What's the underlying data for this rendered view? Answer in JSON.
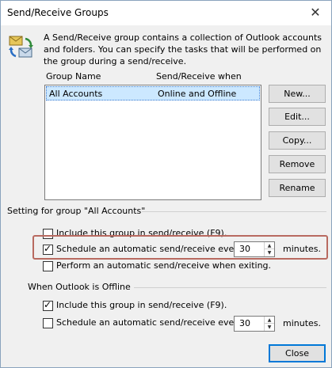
{
  "window": {
    "title": "Send/Receive Groups",
    "close_glyph": "✕"
  },
  "description": "A Send/Receive group contains a collection of Outlook accounts and folders. You can specify the tasks that will be performed on the group during a send/receive.",
  "list": {
    "col_group_name": "Group Name",
    "col_when": "Send/Receive when",
    "rows": [
      {
        "name": "All Accounts",
        "when": "Online and Offline"
      }
    ]
  },
  "buttons": {
    "new": "New...",
    "edit": "Edit...",
    "copy": "Copy...",
    "remove": "Remove",
    "rename": "Rename",
    "close": "Close"
  },
  "setting_group": {
    "label": "Setting for group \"All Accounts\"",
    "include": {
      "label": "Include this group in send/receive (F9).",
      "checked": false
    },
    "schedule": {
      "label": "Schedule an automatic send/receive every",
      "value": "30",
      "unit": "minutes.",
      "checked": true
    },
    "exiting": {
      "label": "Perform an automatic send/receive when exiting.",
      "checked": false
    }
  },
  "offline_group": {
    "label": "When Outlook is Offline",
    "include": {
      "label": "Include this group in send/receive (F9).",
      "checked": true
    },
    "schedule": {
      "label": "Schedule an automatic send/receive every",
      "value": "30",
      "unit": "minutes.",
      "checked": false
    }
  },
  "colors": {
    "selection": "#cce8ff",
    "highlight_box": "#b86a60",
    "default_button_border": "#0078d7"
  }
}
